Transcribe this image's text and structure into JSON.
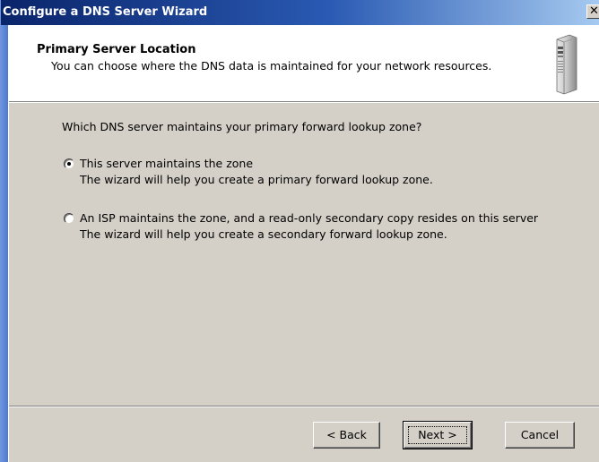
{
  "window": {
    "title": "Configure a DNS Server Wizard",
    "close_glyph": "✕"
  },
  "header": {
    "title": "Primary Server Location",
    "subtitle": "You can choose where the DNS data is maintained for your network resources.",
    "icon": "server-icon"
  },
  "content": {
    "question": "Which DNS server maintains your primary forward lookup zone?",
    "options": [
      {
        "label": "This server maintains the zone",
        "description": "The wizard will help you create a primary forward lookup zone.",
        "selected": true
      },
      {
        "label": "An ISP maintains the zone, and a read-only secondary copy resides on this server",
        "description": "The wizard will help you create a secondary forward lookup zone.",
        "selected": false
      }
    ]
  },
  "buttons": {
    "back": "< Back",
    "next": "Next >",
    "cancel": "Cancel"
  }
}
